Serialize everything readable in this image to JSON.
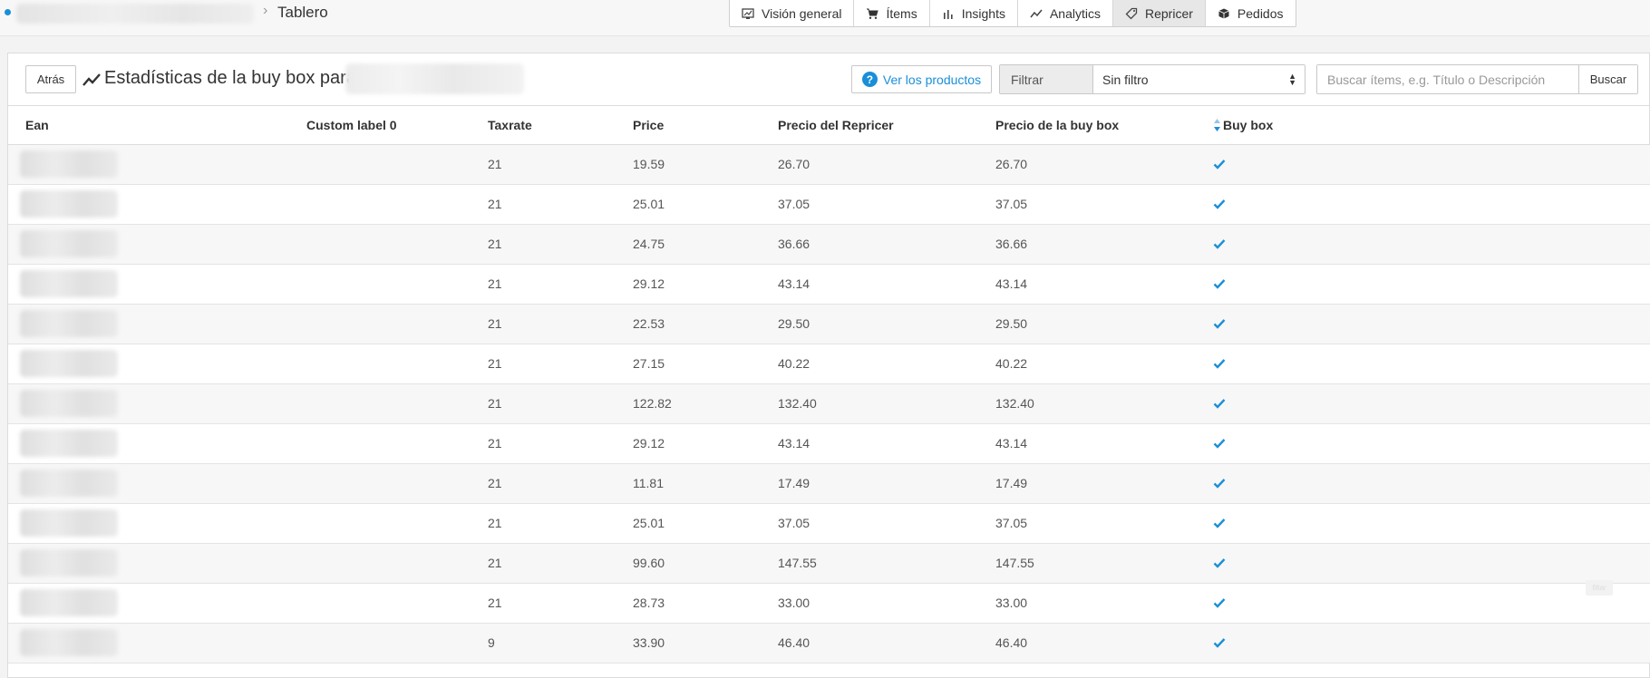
{
  "breadcrumb": {
    "current": "Tablero"
  },
  "nav": {
    "tabs": [
      {
        "label": "Visión general",
        "icon": "dashboard-icon",
        "active": false
      },
      {
        "label": "Ítems",
        "icon": "cart-icon",
        "active": false
      },
      {
        "label": "Insights",
        "icon": "bar-chart-icon",
        "active": false
      },
      {
        "label": "Analytics",
        "icon": "trend-icon",
        "active": false
      },
      {
        "label": "Repricer",
        "icon": "tag-icon",
        "active": true
      },
      {
        "label": "Pedidos",
        "icon": "box-icon",
        "active": false
      }
    ]
  },
  "header": {
    "back_label": "Atrás",
    "title": "Estadísticas de la buy box para:",
    "view_products_label": "Ver los productos",
    "filter_label": "Filtrar",
    "filter_value": "Sin filtro",
    "search_placeholder": "Buscar ítems, e.g. Título o Descripción",
    "search_button": "Buscar"
  },
  "table": {
    "columns": [
      "Ean",
      "Custom label 0",
      "Taxrate",
      "Price",
      "Precio del Repricer",
      "Precio de la buy box",
      "Buy box"
    ],
    "rows": [
      {
        "custom_label": "",
        "taxrate": "21",
        "price": "19.59",
        "repricer": "26.70",
        "buybox_price": "26.70",
        "buybox": true
      },
      {
        "custom_label": "",
        "taxrate": "21",
        "price": "25.01",
        "repricer": "37.05",
        "buybox_price": "37.05",
        "buybox": true
      },
      {
        "custom_label": "",
        "taxrate": "21",
        "price": "24.75",
        "repricer": "36.66",
        "buybox_price": "36.66",
        "buybox": true
      },
      {
        "custom_label": "",
        "taxrate": "21",
        "price": "29.12",
        "repricer": "43.14",
        "buybox_price": "43.14",
        "buybox": true
      },
      {
        "custom_label": "",
        "taxrate": "21",
        "price": "22.53",
        "repricer": "29.50",
        "buybox_price": "29.50",
        "buybox": true
      },
      {
        "custom_label": "",
        "taxrate": "21",
        "price": "27.15",
        "repricer": "40.22",
        "buybox_price": "40.22",
        "buybox": true
      },
      {
        "custom_label": "",
        "taxrate": "21",
        "price": "122.82",
        "repricer": "132.40",
        "buybox_price": "132.40",
        "buybox": true
      },
      {
        "custom_label": "",
        "taxrate": "21",
        "price": "29.12",
        "repricer": "43.14",
        "buybox_price": "43.14",
        "buybox": true
      },
      {
        "custom_label": "",
        "taxrate": "21",
        "price": "11.81",
        "repricer": "17.49",
        "buybox_price": "17.49",
        "buybox": true
      },
      {
        "custom_label": "",
        "taxrate": "21",
        "price": "25.01",
        "repricer": "37.05",
        "buybox_price": "37.05",
        "buybox": true
      },
      {
        "custom_label": "",
        "taxrate": "21",
        "price": "99.60",
        "repricer": "147.55",
        "buybox_price": "147.55",
        "buybox": true
      },
      {
        "custom_label": "",
        "taxrate": "21",
        "price": "28.73",
        "repricer": "33.00",
        "buybox_price": "33.00",
        "buybox": true
      },
      {
        "custom_label": "",
        "taxrate": "9",
        "price": "33.90",
        "repricer": "46.40",
        "buybox_price": "46.40",
        "buybox": true
      }
    ]
  },
  "colors": {
    "accent": "#1a8fd8",
    "check": "#1a8fd8"
  },
  "floating_tag": "filtar"
}
